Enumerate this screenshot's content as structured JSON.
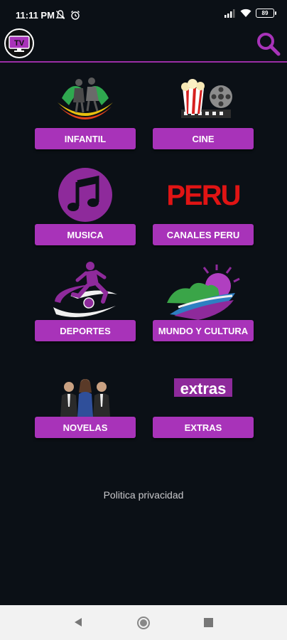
{
  "status": {
    "time": "11:11 PM",
    "battery": "89"
  },
  "app": {
    "logo_text": "TV"
  },
  "categories": [
    {
      "label": "INFANTIL",
      "icon": "kids-icon"
    },
    {
      "label": "CINE",
      "icon": "cinema-icon"
    },
    {
      "label": "MUSICA",
      "icon": "music-note-icon"
    },
    {
      "label": "CANALES PERU",
      "icon": "peru-logo",
      "logo_text": "PERU"
    },
    {
      "label": "DEPORTES",
      "icon": "soccer-player-icon"
    },
    {
      "label": "MUNDO Y CULTURA",
      "icon": "landscape-icon"
    },
    {
      "label": "NOVELAS",
      "icon": "actors-icon"
    },
    {
      "label": "EXTRAS",
      "icon": "extras-logo",
      "logo_text": "extras"
    }
  ],
  "footer": {
    "privacy_link": "Politica privacidad"
  },
  "colors": {
    "background": "#0b1016",
    "accent": "#a833b9",
    "nav_bar": "#f2f2f2"
  }
}
